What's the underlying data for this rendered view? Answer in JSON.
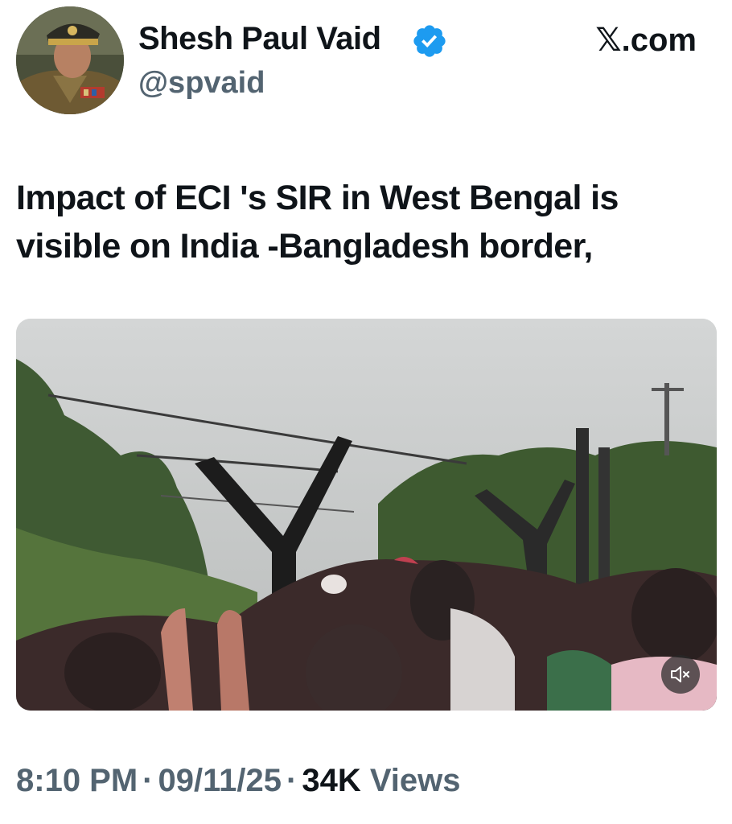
{
  "author": {
    "name": "Shesh Paul Vaid",
    "handle": "@spvaid",
    "verified": true,
    "avatar_icon": "uniformed-officer-avatar"
  },
  "brand": {
    "logo_glyph": "𝕏",
    "logo_suffix": ".com"
  },
  "tweet": {
    "text": "Impact of ECI 's SIR in West Bengal is visible on India -Bangladesh border,"
  },
  "media": {
    "type": "video",
    "description_icon": "border-fence-crowd-video",
    "mute_icon": "speaker-muted-icon"
  },
  "meta": {
    "time": "8:10 PM",
    "date": "09/11/25",
    "views_count": "34K",
    "views_label": "Views",
    "separator": "·"
  },
  "colors": {
    "text_primary": "#0f1419",
    "text_secondary": "#536471",
    "verified_blue": "#1d9bf0"
  }
}
